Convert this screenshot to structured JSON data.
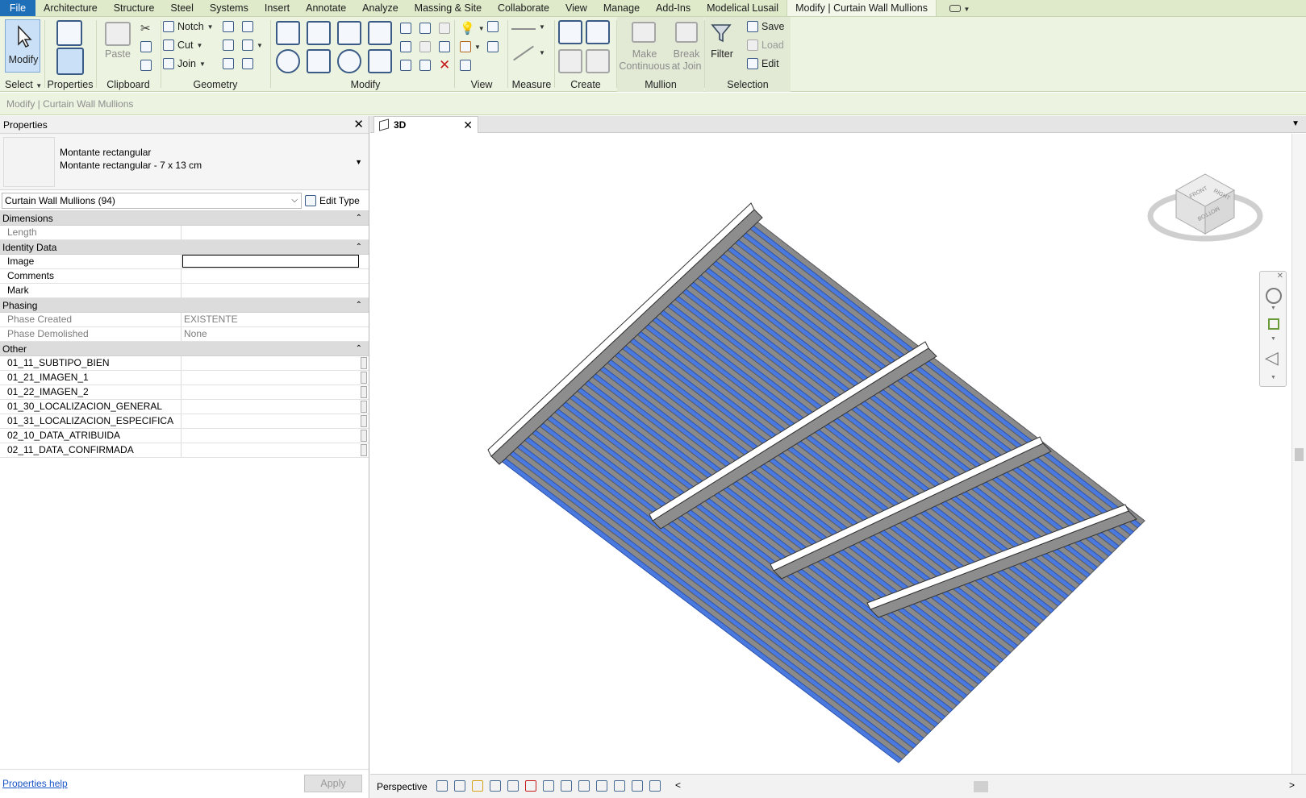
{
  "menu": {
    "tabs": [
      "File",
      "Architecture",
      "Structure",
      "Steel",
      "Systems",
      "Insert",
      "Annotate",
      "Analyze",
      "Massing & Site",
      "Collaborate",
      "View",
      "Manage",
      "Add-Ins",
      "Modelical Lusail",
      "Modify | Curtain Wall Mullions"
    ],
    "active_tab": "Modify | Curtain Wall Mullions"
  },
  "ribbon": {
    "select": {
      "modify_label": "Modify",
      "panel_title": "Select"
    },
    "properties": {
      "panel_title": "Properties"
    },
    "clipboard": {
      "paste_label": "Paste",
      "panel_title": "Clipboard"
    },
    "geometry": {
      "notch_label": "Notch",
      "cut_label": "Cut",
      "join_label": "Join",
      "panel_title": "Geometry"
    },
    "modify": {
      "panel_title": "Modify"
    },
    "view": {
      "panel_title": "View"
    },
    "measure": {
      "panel_title": "Measure"
    },
    "create": {
      "panel_title": "Create"
    },
    "mullion": {
      "make_continuous_label_1": "Make",
      "make_continuous_label_2": "Continuous",
      "break_label_1": "Break",
      "break_label_2": "at Join",
      "panel_title": "Mullion"
    },
    "selection": {
      "filter_label": "Filter",
      "save_label": "Save",
      "load_label": "Load",
      "edit_label": "Edit",
      "panel_title": "Selection"
    }
  },
  "options_bar": {
    "text": "Modify | Curtain Wall Mullions"
  },
  "properties_palette": {
    "title": "Properties",
    "type_name_1": "Montante rectangular",
    "type_name_2": "Montante rectangular - 7 x 13 cm",
    "instance_filter": "Curtain Wall Mullions (94)",
    "edit_type_label": "Edit Type",
    "sections": {
      "dimensions": {
        "title": "Dimensions",
        "rows": [
          {
            "key": "Length",
            "value": ""
          }
        ]
      },
      "identity": {
        "title": "Identity Data",
        "rows": [
          {
            "key": "Image",
            "value": ""
          },
          {
            "key": "Comments",
            "value": ""
          },
          {
            "key": "Mark",
            "value": ""
          }
        ]
      },
      "phasing": {
        "title": "Phasing",
        "rows": [
          {
            "key": "Phase Created",
            "value": "EXISTENTE"
          },
          {
            "key": "Phase Demolished",
            "value": "None"
          }
        ]
      },
      "other": {
        "title": "Other",
        "rows": [
          {
            "key": "01_11_SUBTIPO_BIEN",
            "value": ""
          },
          {
            "key": "01_21_IMAGEN_1",
            "value": ""
          },
          {
            "key": "01_22_IMAGEN_2",
            "value": ""
          },
          {
            "key": "01_30_LOCALIZACION_GENERAL",
            "value": ""
          },
          {
            "key": "01_31_LOCALIZACION_ESPECIFICA",
            "value": ""
          },
          {
            "key": "02_10_DATA_ATRIBUIDA",
            "value": ""
          },
          {
            "key": "02_11_DATA_CONFIRMADA",
            "value": ""
          }
        ]
      }
    },
    "help_link": "Properties help",
    "apply_label": "Apply"
  },
  "view": {
    "tab_label": "3D",
    "viewcube": {
      "front": "FRONT",
      "right": "RIGHT",
      "bottom": "BOTTOM"
    },
    "status": {
      "perspective_label": "Perspective"
    }
  },
  "colors": {
    "ribbon_bg": "#ecf3e0",
    "menu_bg": "#dfeacb",
    "file_tab": "#1f6fb8",
    "mullion_blue": "#4a79df",
    "panel_gray": "#8a8a8a",
    "beam_white": "#ffffff"
  }
}
